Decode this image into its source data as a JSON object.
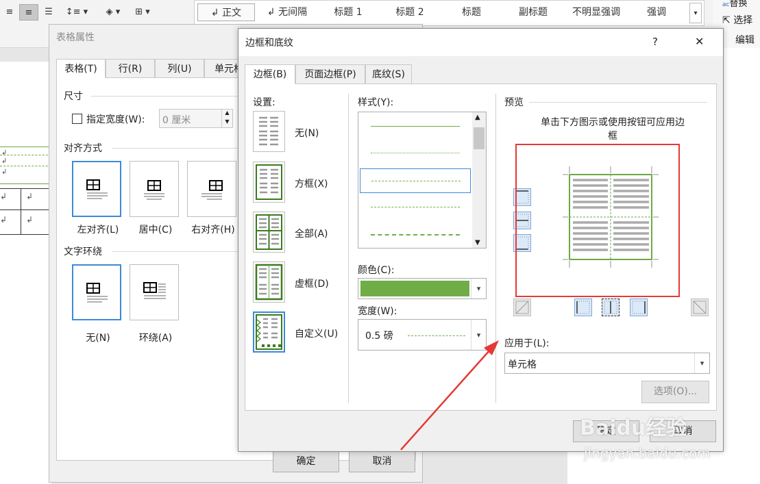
{
  "ribbon": {
    "styles": [
      {
        "label": "↲ 正文",
        "selected": true
      },
      {
        "label": "↲ 无间隔",
        "selected": false
      },
      {
        "label": "标题 1",
        "selected": false
      },
      {
        "label": "标题 2",
        "selected": false
      },
      {
        "label": "标题",
        "selected": false
      },
      {
        "label": "副标题",
        "selected": false
      },
      {
        "label": "不明显强调",
        "selected": false
      },
      {
        "label": "强调",
        "selected": false
      }
    ],
    "right": {
      "replace": "替换",
      "select": "选择",
      "group": "编辑"
    }
  },
  "table_props": {
    "title": "表格属性",
    "tabs": [
      "表格(T)",
      "行(R)",
      "列(U)",
      "单元格"
    ],
    "size": {
      "label": "尺寸",
      "checkbox_label": "指定宽度(W):",
      "width_value": "0 厘米"
    },
    "align": {
      "label": "对齐方式",
      "options": [
        "左对齐(L)",
        "居中(C)",
        "右对齐(H)"
      ]
    },
    "wrap": {
      "label": "文字环绕",
      "options": [
        "无(N)",
        "环绕(A)"
      ]
    },
    "ok": "确定",
    "cancel": "取消"
  },
  "borders_dialog": {
    "title": "边框和底纹",
    "help": "?",
    "close": "✕",
    "tabs": [
      "边框(B)",
      "页面边框(P)",
      "底纹(S)"
    ],
    "settings_label": "设置:",
    "settings": [
      "无(N)",
      "方框(X)",
      "全部(A)",
      "虚框(D)",
      "自定义(U)"
    ],
    "style_label": "样式(Y):",
    "color_label": "颜色(C):",
    "color_value": "#70ad47",
    "width_label": "宽度(W):",
    "width_value": "0.5 磅",
    "preview_label": "预览",
    "preview_hint": "单击下方图示或使用按钮可应用边框",
    "apply_label": "应用于(L):",
    "apply_value": "单元格",
    "options_button": "选项(O)...",
    "ok": "确定",
    "cancel": "取消"
  },
  "watermark": {
    "brand": "Baidu经验",
    "url": "jingyan.baidu.com"
  }
}
